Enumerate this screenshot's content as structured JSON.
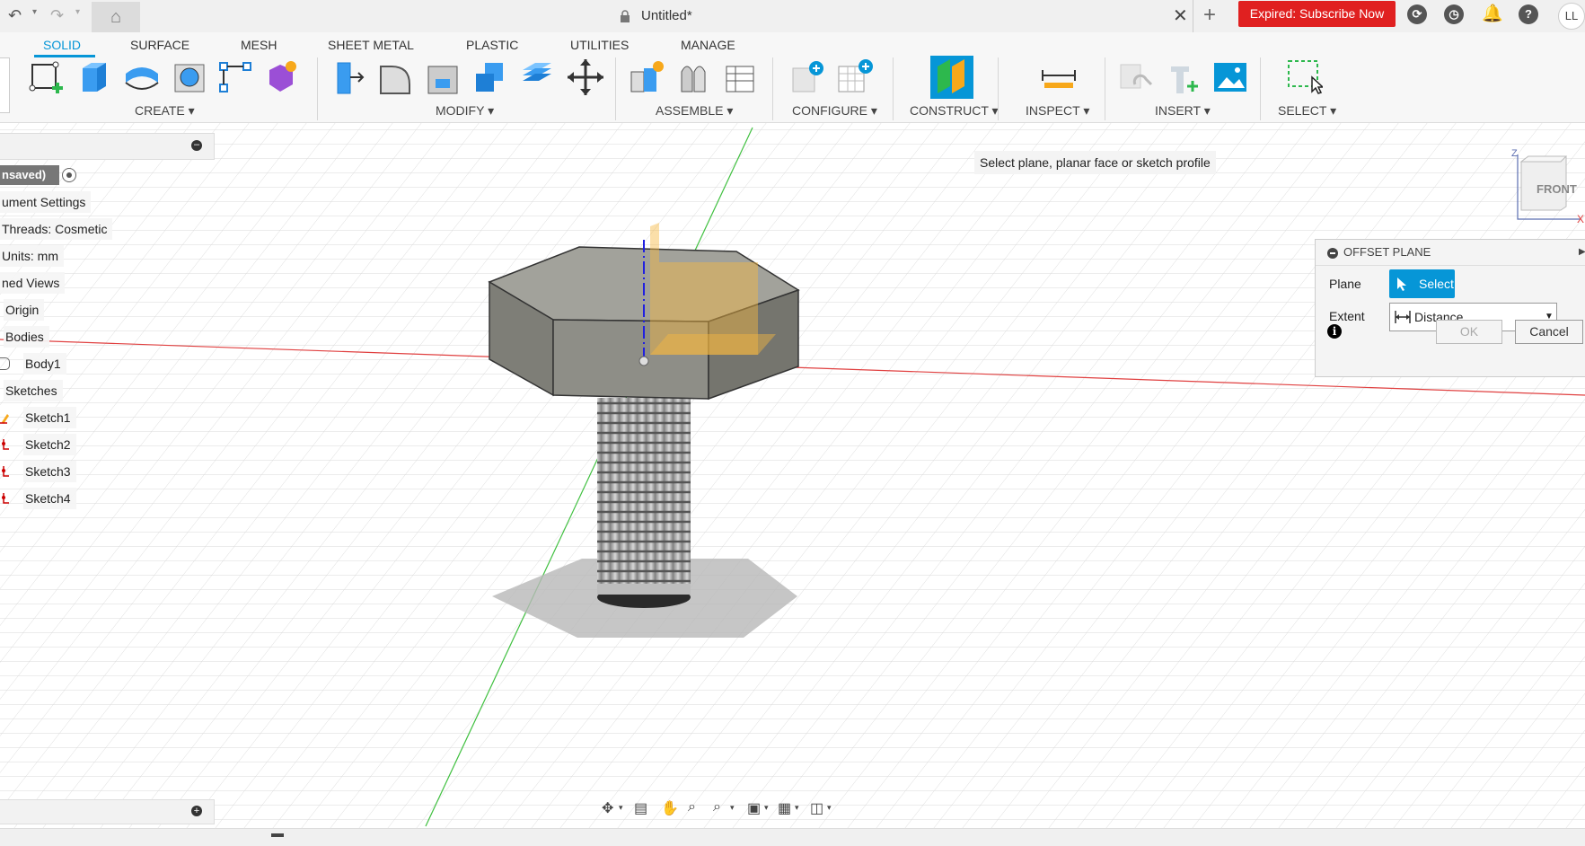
{
  "titlebar": {
    "doc_title": "Untitled*",
    "expired_label": "Expired: Subscribe Now",
    "user_initials": "LL",
    "icons": [
      "undo-icon",
      "redo-icon",
      "home-icon",
      "lock-icon",
      "close-icon",
      "plus-icon",
      "extensions-icon",
      "job-status-icon",
      "notifications-icon",
      "help-icon"
    ]
  },
  "ribbon": {
    "tabs": [
      "SOLID",
      "SURFACE",
      "MESH",
      "SHEET METAL",
      "PLASTIC",
      "UTILITIES",
      "MANAGE"
    ],
    "active_tab": "SOLID",
    "groups": {
      "create": "CREATE ▾",
      "modify": "MODIFY ▾",
      "assemble": "ASSEMBLE ▾",
      "configure": "CONFIGURE ▾",
      "construct": "CONSTRUCT ▾",
      "inspect": "INSPECT ▾",
      "insert": "INSERT ▾",
      "select": "SELECT ▾"
    }
  },
  "prompt": "Select plane, planar face or sketch profile",
  "browser": {
    "doc_node": "nsaved)",
    "items": [
      "ument Settings",
      "Threads: Cosmetic",
      "Units: mm",
      "ned Views",
      "Origin",
      "Bodies",
      "Body1",
      "Sketches",
      "Sketch1",
      "Sketch2",
      "Sketch3",
      "Sketch4"
    ]
  },
  "dialog": {
    "title": "OFFSET PLANE",
    "plane_label": "Plane",
    "plane_button": "Select",
    "extent_label": "Extent",
    "extent_value": "Distance",
    "ok_label": "OK",
    "cancel_label": "Cancel"
  },
  "viewcube": {
    "face": "FRONT",
    "axis_z": "Z",
    "axis_x": "X"
  },
  "colors": {
    "accent": "#0696d7",
    "expired": "#e02020",
    "x_axis": "#e04040",
    "y_axis": "#40c040",
    "z_axis": "#2020e0",
    "plane_preview": "#f6b740",
    "body": "#8a8a82"
  }
}
